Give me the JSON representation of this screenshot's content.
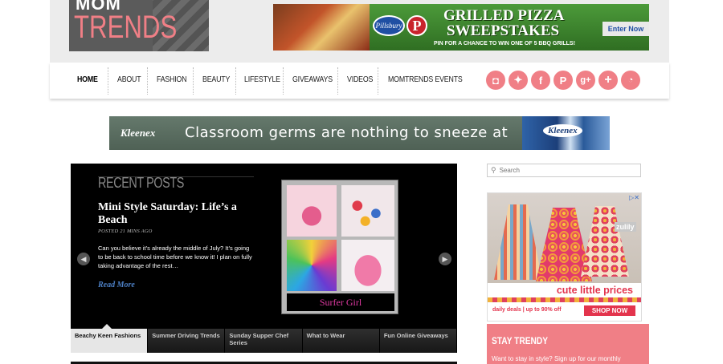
{
  "logo": {
    "line1": "MOM",
    "line2": "TRENDS"
  },
  "banner_ad": {
    "brand": "Pillsbury",
    "title_line1": "GRILLED PIZZA",
    "title_line2": "SWEEPSTAKES",
    "subtitle": "PIN FOR A CHANCE TO WIN ONE OF 5 BBQ GRILLS!",
    "cta": "Enter Now"
  },
  "nav": {
    "items": [
      "HOME",
      "ABOUT",
      "FASHION",
      "BEAUTY",
      "LIFESTYLE",
      "GIVEAWAYS",
      "VIDEOS",
      "MOMTRENDS EVENTS"
    ],
    "active": "HOME",
    "social_icons": [
      "instagram-icon",
      "twitter-icon",
      "facebook-icon",
      "pinterest-icon",
      "google-plus-icon",
      "plus-icon",
      "rss-icon"
    ],
    "social_color": "#f07f86"
  },
  "kleenex_ad": {
    "brand": "Kleenex",
    "message": "Classroom germs are nothing to sneeze at"
  },
  "slider": {
    "heading": "RECENT POSTS",
    "post_title": "Mini Style Saturday: Life’s a Beach",
    "posted": "POSTED 21 MINS AGO",
    "excerpt": "Can you believe it’s already the middle of July? It’s going to be back to school time before we know it! I plan on fully taking advantage of the rest…",
    "read_more": "Read More",
    "image_caption": "Surfer Girl",
    "tabs": [
      "Beachy Keen Fashions",
      "Summer Driving Trends",
      "Sunday Supper Chef Series",
      "What to Wear",
      "Fun Online Giveaways"
    ],
    "active_tab": 0
  },
  "sidebar": {
    "search_placeholder": "Search",
    "ad": {
      "brand": "zulily",
      "tagline": "cute little prices",
      "deals": "daily deals | up to 90% off",
      "cta": "SHOP NOW"
    },
    "stay_trendy": {
      "title": "STAY TRENDY",
      "text": "Want to stay in style? Sign up for our monthly"
    }
  }
}
